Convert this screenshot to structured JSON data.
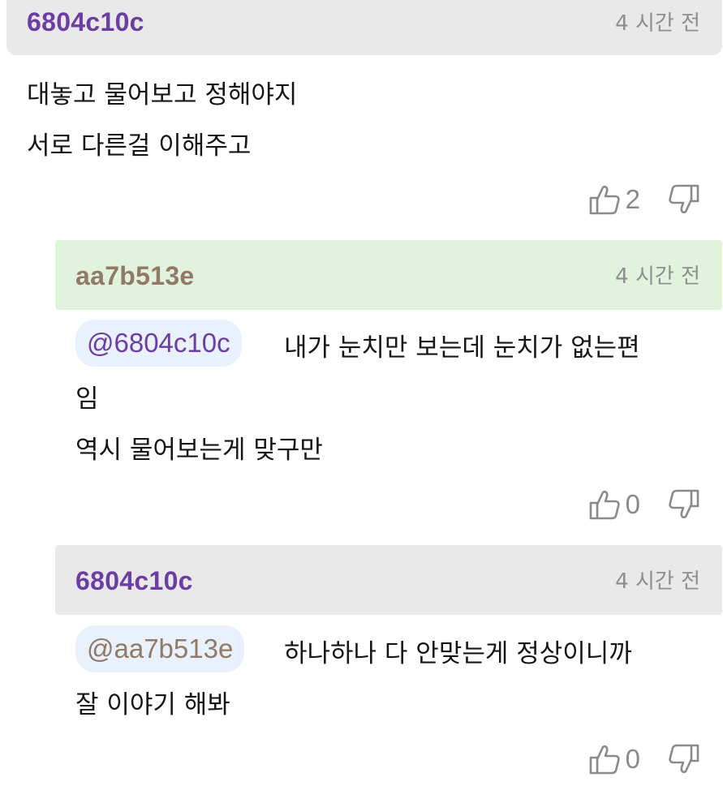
{
  "comments": [
    {
      "nickname": "6804c10c",
      "time": "4 시간 전",
      "mention": "",
      "lines": [
        "대놓고 물어보고 정해야지",
        "서로 다른걸 이해주고"
      ],
      "likes": "2"
    },
    {
      "nickname": "aa7b513e",
      "time": "4 시간 전",
      "mention": "@6804c10c",
      "lines": [
        "내가 눈치만 보는데 눈치가 없는편",
        "임",
        "역시 물어보는게 맞구만"
      ],
      "likes": "0"
    },
    {
      "nickname": "6804c10c",
      "time": "4 시간 전",
      "mention": "@aa7b513e",
      "lines": [
        "하나하나 다 안맞는게 정상이니까",
        "잘 이야기 해봐"
      ],
      "likes": "0"
    }
  ],
  "icons": {
    "like": "thumbs-up-icon",
    "dislike": "thumbs-down-icon"
  },
  "colors": {
    "nickname_purple": "#6c3ea3",
    "nickname_brown": "#917a68",
    "header_gray": "#e9e9ea",
    "header_green": "#e1f3dc",
    "mention_bg": "#e8f1fc"
  }
}
